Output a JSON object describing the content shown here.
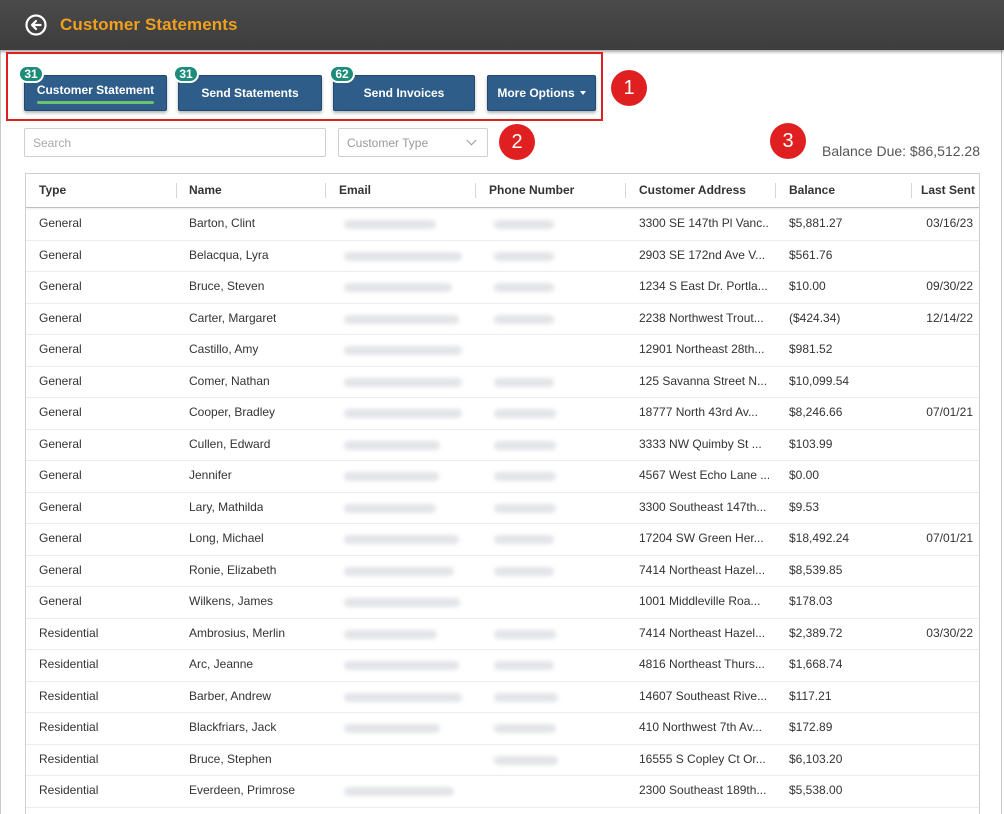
{
  "header": {
    "title": "Customer Statements"
  },
  "buttons": {
    "customer_statement": {
      "label": "Customer Statement",
      "badge": "31"
    },
    "send_statements": {
      "label": "Send Statements",
      "badge": "31"
    },
    "send_invoices": {
      "label": "Send Invoices",
      "badge": "62"
    },
    "more_options": {
      "label": "More Options"
    }
  },
  "markers": [
    "1",
    "2",
    "3"
  ],
  "filters": {
    "search_placeholder": "Search",
    "customer_type_placeholder": "Customer Type"
  },
  "balance_due": "Balance Due: $86,512.28",
  "table": {
    "columns": [
      "Type",
      "Name",
      "Email",
      "Phone Number",
      "Customer Address",
      "Balance",
      "Last Sent"
    ],
    "rows": [
      {
        "type": "General",
        "name": "Barton, Clint",
        "address": "3300 SE 147th Pl Vanc...",
        "balance": "$5,881.27",
        "last_sent": "03/16/23"
      },
      {
        "type": "General",
        "name": "Belacqua, Lyra",
        "address": "2903 SE 172nd Ave V...",
        "balance": "$561.76",
        "last_sent": ""
      },
      {
        "type": "General",
        "name": "Bruce, Steven",
        "address": "1234 S East Dr. Portla...",
        "balance": "$10.00",
        "last_sent": "09/30/22"
      },
      {
        "type": "General",
        "name": "Carter, Margaret",
        "address": "2238 Northwest Trout...",
        "balance": "($424.34)",
        "last_sent": "12/14/22"
      },
      {
        "type": "General",
        "name": "Castillo, Amy",
        "address": "12901 Northeast 28th...",
        "balance": "$981.52",
        "last_sent": ""
      },
      {
        "type": "General",
        "name": "Comer, Nathan",
        "address": "125 Savanna Street N...",
        "balance": "$10,099.54",
        "last_sent": ""
      },
      {
        "type": "General",
        "name": "Cooper, Bradley",
        "address": "18777 North 43rd Av...",
        "balance": "$8,246.66",
        "last_sent": "07/01/21"
      },
      {
        "type": "General",
        "name": "Cullen, Edward",
        "address": "3333 NW Quimby St ...",
        "balance": "$103.99",
        "last_sent": ""
      },
      {
        "type": "General",
        "name": "Jennifer",
        "address": "4567 West Echo Lane ...",
        "balance": "$0.00",
        "last_sent": ""
      },
      {
        "type": "General",
        "name": "Lary, Mathilda",
        "address": "3300 Southeast 147th...",
        "balance": "$9.53",
        "last_sent": ""
      },
      {
        "type": "General",
        "name": "Long, Michael",
        "address": "17204 SW Green Her...",
        "balance": "$18,492.24",
        "last_sent": "07/01/21"
      },
      {
        "type": "General",
        "name": "Ronie, Elizabeth",
        "address": "7414 Northeast Hazel...",
        "balance": "$8,539.85",
        "last_sent": ""
      },
      {
        "type": "General",
        "name": "Wilkens, James",
        "address": "1001 Middleville Roa...",
        "balance": "$178.03",
        "last_sent": ""
      },
      {
        "type": "Residential",
        "name": "Ambrosius, Merlin",
        "address": "7414 Northeast Hazel...",
        "balance": "$2,389.72",
        "last_sent": "03/30/22"
      },
      {
        "type": "Residential",
        "name": "Arc, Jeanne",
        "address": "4816 Northeast Thurs...",
        "balance": "$1,668.74",
        "last_sent": ""
      },
      {
        "type": "Residential",
        "name": "Barber, Andrew",
        "address": "14607 Southeast Rive...",
        "balance": "$117.21",
        "last_sent": ""
      },
      {
        "type": "Residential",
        "name": "Blackfriars, Jack",
        "address": "410 Northwest 7th Av...",
        "balance": "$172.89",
        "last_sent": ""
      },
      {
        "type": "Residential",
        "name": "Bruce, Stephen",
        "address": "16555 S Copley Ct Or...",
        "balance": "$6,103.20",
        "last_sent": ""
      },
      {
        "type": "Residential",
        "name": "Everdeen, Primrose",
        "address": "2300 Southeast 189th...",
        "balance": "$5,538.00",
        "last_sent": ""
      }
    ]
  },
  "colors": {
    "title": "#f0a01e",
    "button": "#2f5d8a",
    "badge": "#1e8c7a",
    "marker": "#e02020",
    "active_underline": "#6cc36c"
  }
}
